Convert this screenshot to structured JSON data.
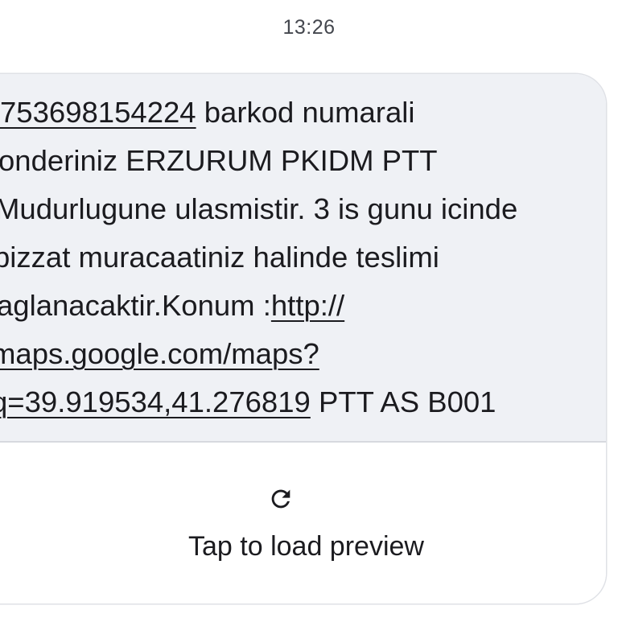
{
  "status_bar": {
    "time": "13:26"
  },
  "message": {
    "lines": [
      {
        "link": "753698154224",
        "text": " barkod numarali"
      },
      {
        "text": "onderiniz ERZURUM PKIDM PTT"
      },
      {
        "text": "Mudurlugune  ulasmistir. 3 is gunu icinde"
      },
      {
        "text": "bizzat muracaatiniz halinde teslimi"
      },
      {
        "text": "aglanacaktir.Konum :",
        "link": "http://"
      },
      {
        "link": "maps.google.com/maps?"
      },
      {
        "link": "q=39.919534,41.276819",
        "text": " PTT AS B001"
      }
    ]
  },
  "preview": {
    "icon": "refresh-icon",
    "label": "Tap to load preview"
  },
  "colors": {
    "bubble_background": "#eff1f5",
    "text": "#1b1b1f",
    "timestamp": "#44474e"
  }
}
